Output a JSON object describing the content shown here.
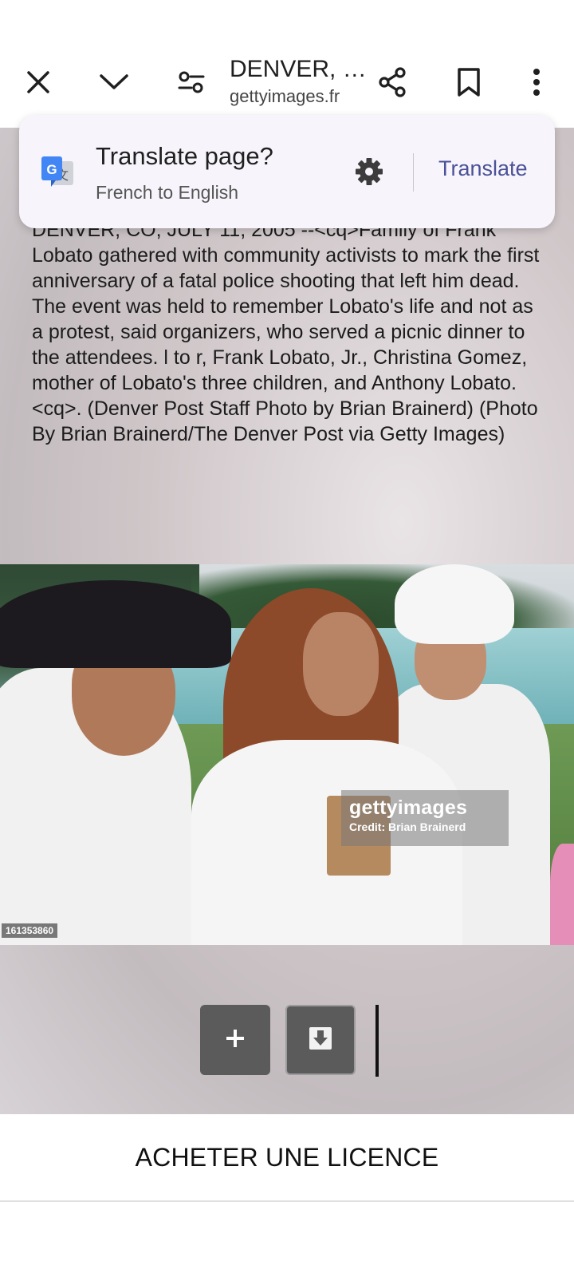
{
  "toolbar": {
    "title": "DENVER, …",
    "url": "gettyimages.fr",
    "icons": [
      "close-icon",
      "chevron-down-icon",
      "page-controls-icon",
      "share-icon",
      "bookmark-icon",
      "more-vert-icon"
    ]
  },
  "translate_prompt": {
    "title": "Translate page?",
    "subtitle": "French to English",
    "action": "Translate",
    "accent_color": "#4a5196"
  },
  "caption": "DENVER, CO, JULY 11, 2005 --<cq>Family of Frank Lobato gathered with community activists to mark the first anniversary of a fatal police shooting that left him dead. The event was held to remember Lobato's life and not as a protest, said organizers, who served a picnic dinner to the attendees. l to r, Frank Lobato, Jr., Christina Gomez, mother of Lobato's three children, and Anthony Lobato. <cq>. (Denver Post Staff Photo by Brian Brainerd) (Photo By Brian Brainerd/The Denver Post via Getty Images)",
  "photo": {
    "watermark_logo": "gettyimages",
    "credit": "Credit: Brian Brainerd",
    "image_id": "161353860"
  },
  "actions": {
    "add_icon": "plus-icon",
    "download_icon": "download-icon"
  },
  "license_button": "ACHETER UNE LICENCE"
}
